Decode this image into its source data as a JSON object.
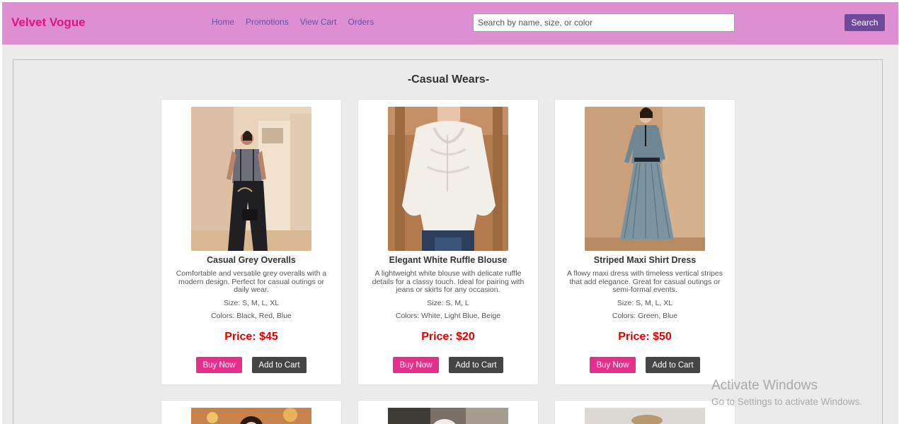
{
  "header": {
    "brand": "Velvet Vogue",
    "nav": [
      "Home",
      "Promotions",
      "View Cart",
      "Orders"
    ],
    "search_placeholder": "Search by name, size, or color",
    "search_button": "Search"
  },
  "section": {
    "title": "-Casual Wears-"
  },
  "products": [
    {
      "name": "Casual Grey Overalls",
      "description": "Comfortable and versatile grey overalls with a modern design. Perfect for casual outings or daily wear.",
      "size": "Size: S, M, L, XL",
      "colors": "Colors: Black, Red, Blue",
      "price": "Price: $45",
      "buy_label": "Buy Now",
      "cart_label": "Add to Cart"
    },
    {
      "name": "Elegant White Ruffle Blouse",
      "description": "A lightweight white blouse with delicate ruffle details for a classy touch. Ideal for pairing with jeans or skirts for any occasion.",
      "size": "Size: S, M, L",
      "colors": "Colors: White, Light Blue, Beige",
      "price": "Price: $20",
      "buy_label": "Buy Now",
      "cart_label": "Add to Cart"
    },
    {
      "name": "Striped Maxi Shirt Dress",
      "description": "A flowy maxi dress with timeless vertical stripes that add elegance. Great for casual outings or semi-formal events.",
      "size": "Size: S, M, L, XL",
      "colors": "Colors: Green, Blue",
      "price": "Price: $50",
      "buy_label": "Buy Now",
      "cart_label": "Add to Cart"
    }
  ],
  "watermark": {
    "line1": "Activate Windows",
    "line2": "Go to Settings to activate Windows."
  }
}
